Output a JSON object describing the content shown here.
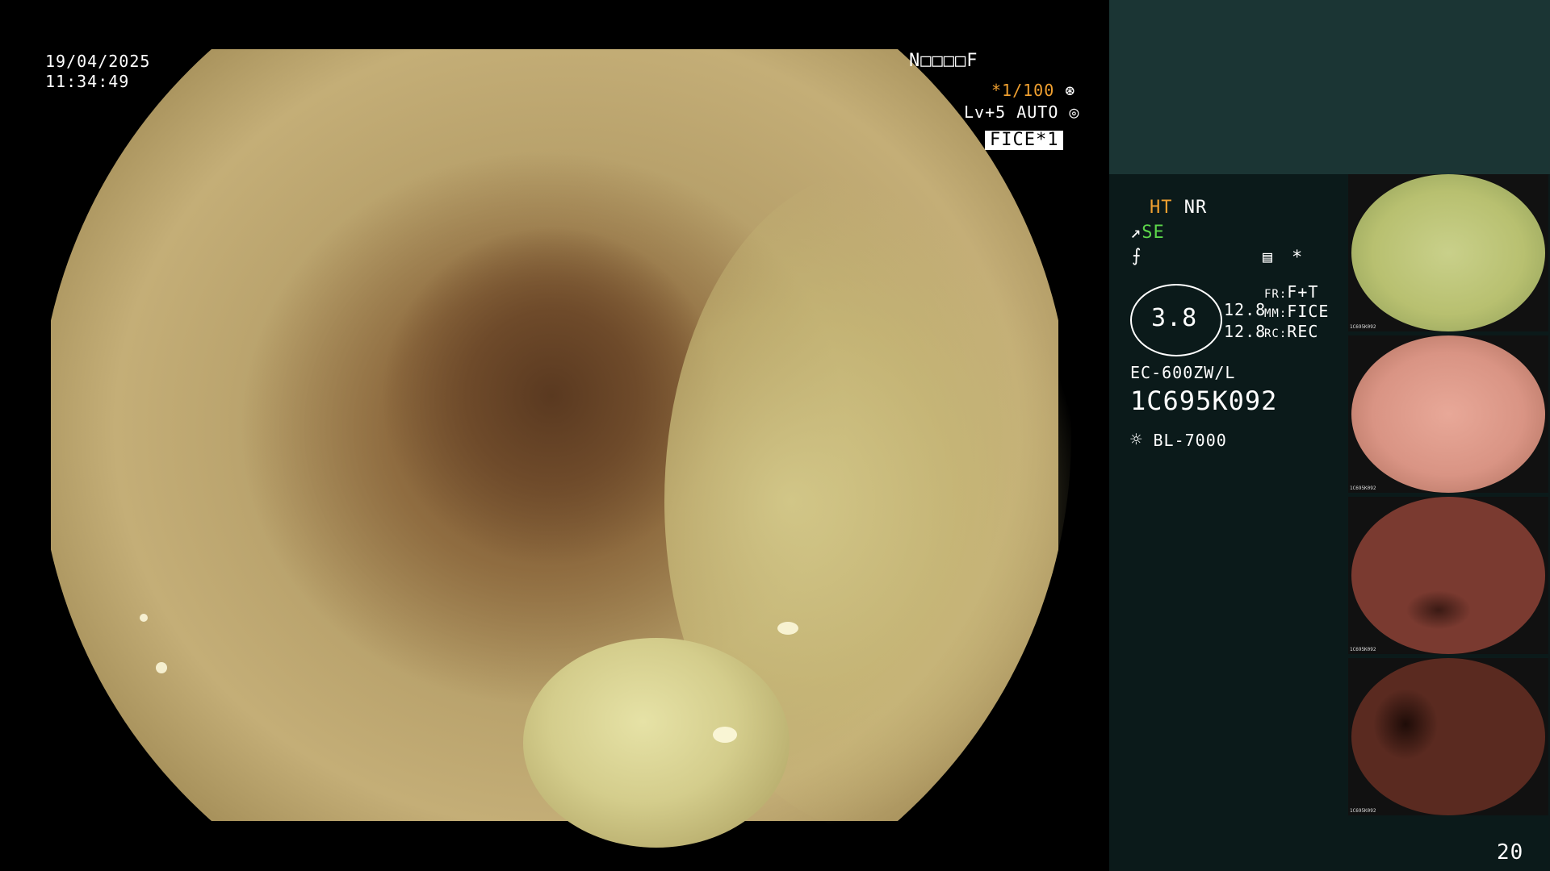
{
  "overlay": {
    "date": "19/04/2025",
    "time": "11:34:49",
    "patient_name": "N□□□□F",
    "shutter": "*1/100",
    "level": "Lv+5 AUTO",
    "mode_badge": "FICE*1"
  },
  "side_panel": {
    "ht": "HT",
    "nr": "NR",
    "se": "SE",
    "asterisk": "*",
    "gauge_value": "3.8",
    "val1": "12.8",
    "val2": "12.8",
    "fr_label": "FR:",
    "fr_value": "F+T",
    "mm_label": "MM:",
    "mm_value": "FICE",
    "rc_label": "RC:",
    "rc_value": "REC",
    "scope_model": "EC-600ZW/L",
    "serial": "1C695K092",
    "light_source": "BL-7000",
    "page_number": "20"
  },
  "thumbnails": [
    {
      "label": "1C695K092",
      "color_main": "#c9d08a",
      "color_edge": "#8a9a55"
    },
    {
      "label": "1C695K092",
      "color_main": "#e8a898",
      "color_edge": "#a86a58"
    },
    {
      "label": "1C695K092",
      "color_main": "#e0a28e",
      "color_edge": "#7a3a30"
    },
    {
      "label": "1C695K092",
      "color_main": "#d8a488",
      "color_edge": "#5a2a20"
    }
  ],
  "colors": {
    "orange_text": "#f0a030",
    "green_text": "#5cd64a",
    "panel_bg": "#0b1a1a",
    "panel_top_bg": "#1b3534"
  }
}
